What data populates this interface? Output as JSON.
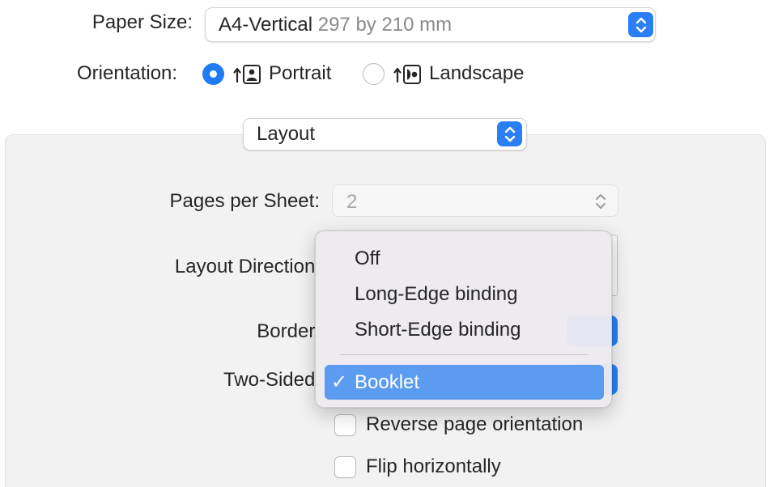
{
  "paper_size": {
    "label": "Paper Size:",
    "value": "A4-Vertical",
    "dimensions": "297 by 210 mm"
  },
  "orientation": {
    "label": "Orientation:",
    "options": [
      {
        "label": "Portrait",
        "selected": true
      },
      {
        "label": "Landscape",
        "selected": false
      }
    ]
  },
  "section_select": {
    "value": "Layout"
  },
  "layout": {
    "pages_per_sheet": {
      "label": "Pages per Sheet:",
      "value": "2"
    },
    "layout_direction": {
      "label": "Layout Direction:"
    },
    "border": {
      "label": "Border:"
    },
    "two_sided": {
      "label": "Two-Sided:"
    },
    "reverse": {
      "label": "Reverse page orientation",
      "checked": false
    },
    "flip": {
      "label": "Flip horizontally",
      "checked": false
    }
  },
  "two_sided_menu": {
    "items": [
      "Off",
      "Long-Edge binding",
      "Short-Edge binding"
    ],
    "selected": "Booklet",
    "check_glyph": "✓"
  },
  "colors": {
    "accent": "#1f7cf5",
    "selection": "#5b9cf0"
  }
}
